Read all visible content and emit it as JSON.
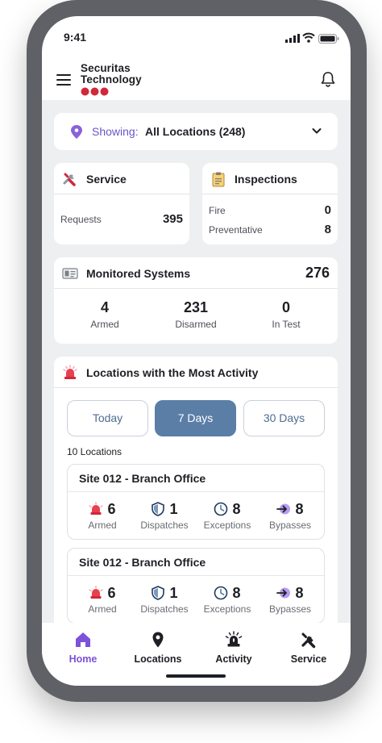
{
  "status": {
    "time": "9:41"
  },
  "brand": {
    "line1": "Securitas",
    "line2": "Technology",
    "accent": "#d1283a"
  },
  "showing": {
    "label": "Showing:",
    "value": "All Locations (248)"
  },
  "service": {
    "title": "Service",
    "rows": [
      {
        "label": "Requests",
        "value": "395"
      }
    ]
  },
  "inspections": {
    "title": "Inspections",
    "rows": [
      {
        "label": "Fire",
        "value": "0"
      },
      {
        "label": "Preventative",
        "value": "8"
      }
    ]
  },
  "monitored": {
    "title": "Monitored Systems",
    "total": "276",
    "stats": [
      {
        "value": "4",
        "label": "Armed"
      },
      {
        "value": "231",
        "label": "Disarmed"
      },
      {
        "value": "0",
        "label": "In Test"
      }
    ]
  },
  "activity": {
    "title": "Locations with the Most Activity",
    "tabs": [
      {
        "label": "Today"
      },
      {
        "label": "7 Days",
        "selected": true
      },
      {
        "label": "30 Days"
      }
    ],
    "count_label": "10 Locations",
    "sites": [
      {
        "title": "Site 012 - Branch Office",
        "stats": [
          {
            "icon": "siren-icon",
            "value": "6",
            "label": "Armed"
          },
          {
            "icon": "shield-icon",
            "value": "1",
            "label": "Dispatches"
          },
          {
            "icon": "clock-icon",
            "value": "8",
            "label": "Exceptions"
          },
          {
            "icon": "bypass-icon",
            "value": "8",
            "label": "Bypasses"
          }
        ]
      },
      {
        "title": "Site 012 - Branch Office",
        "stats": [
          {
            "icon": "siren-icon",
            "value": "6",
            "label": "Armed"
          },
          {
            "icon": "shield-icon",
            "value": "1",
            "label": "Dispatches"
          },
          {
            "icon": "clock-icon",
            "value": "8",
            "label": "Exceptions"
          },
          {
            "icon": "bypass-icon",
            "value": "8",
            "label": "Bypasses"
          }
        ]
      }
    ]
  },
  "nav": {
    "items": [
      {
        "label": "Home",
        "icon": "home-icon",
        "active": true
      },
      {
        "label": "Locations",
        "icon": "location-pin-icon"
      },
      {
        "label": "Activity",
        "icon": "alarm-light-icon"
      },
      {
        "label": "Service",
        "icon": "tools-icon"
      }
    ]
  },
  "colors": {
    "active_nav": "#7b52d9",
    "selected_tab": "#5b7ea6",
    "background": "#eeeff1"
  }
}
